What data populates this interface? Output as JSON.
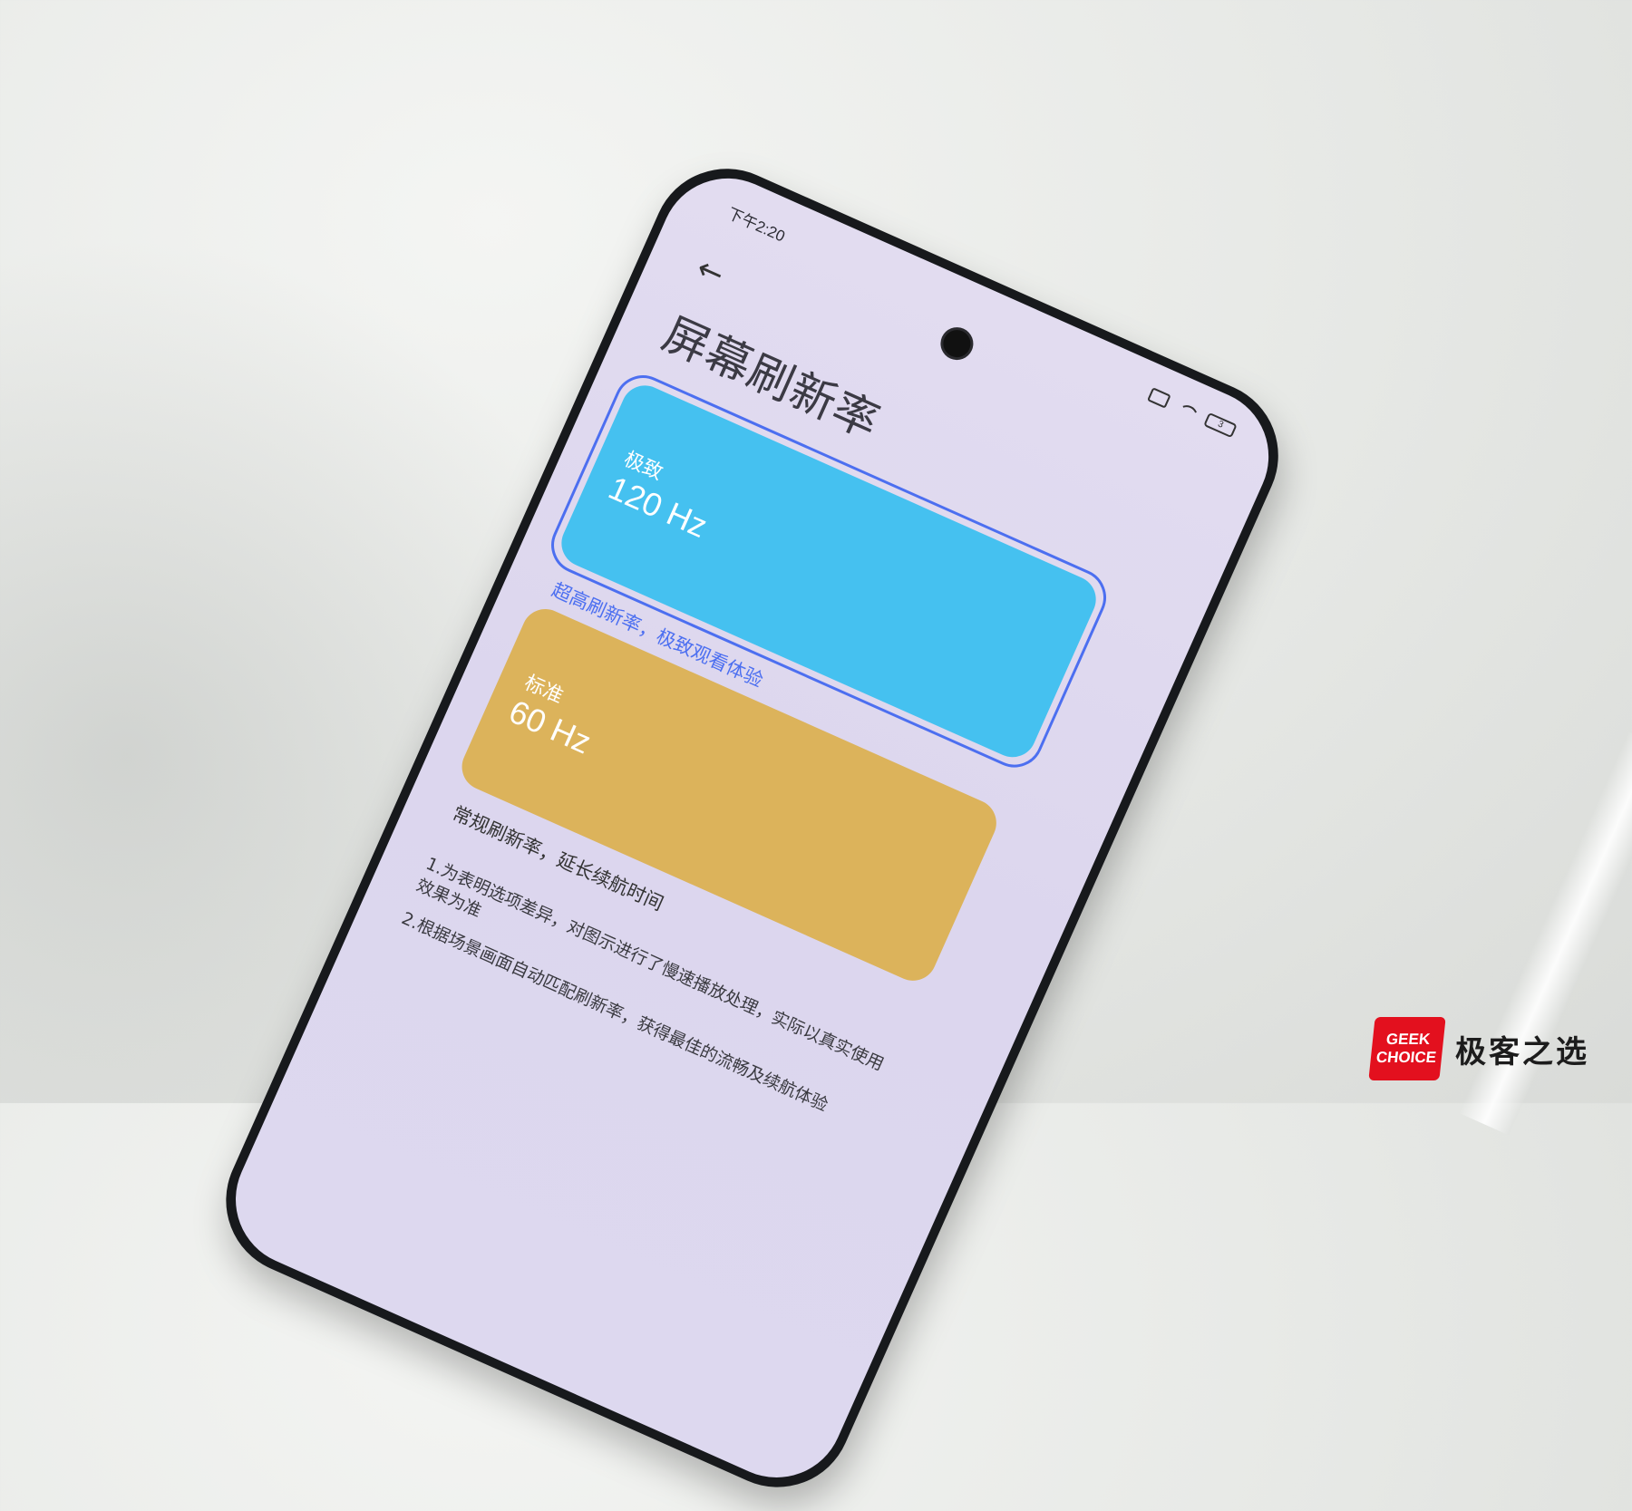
{
  "status_bar": {
    "time": "下午2:20",
    "battery": "3"
  },
  "icons": {
    "back": "back-arrow-icon",
    "sim": "no-sim-icon",
    "wifi": "wifi-icon",
    "battery": "battery-icon"
  },
  "page": {
    "back_glyph": "←",
    "title": "屏幕刷新率"
  },
  "options": [
    {
      "label": "极致",
      "rate": "120 Hz",
      "description": "超高刷新率，极致观看体验",
      "color": "#45c1f0",
      "selected": true
    },
    {
      "label": "标准",
      "rate": "60 Hz",
      "description": "常规刷新率，延长续航时间",
      "color": "#dcb35b",
      "selected": false
    }
  ],
  "notes": [
    "1.为表明选项差异，对图示进行了慢速播放处理，实际以真实使用效果为准",
    "2.根据场景画面自动匹配刷新率，获得最佳的流畅及续航体验"
  ],
  "accent_color": "#4c6ff0",
  "watermark": {
    "logo_line1": "GEEK",
    "logo_line2": "CHOICE",
    "text": "极客之选"
  }
}
